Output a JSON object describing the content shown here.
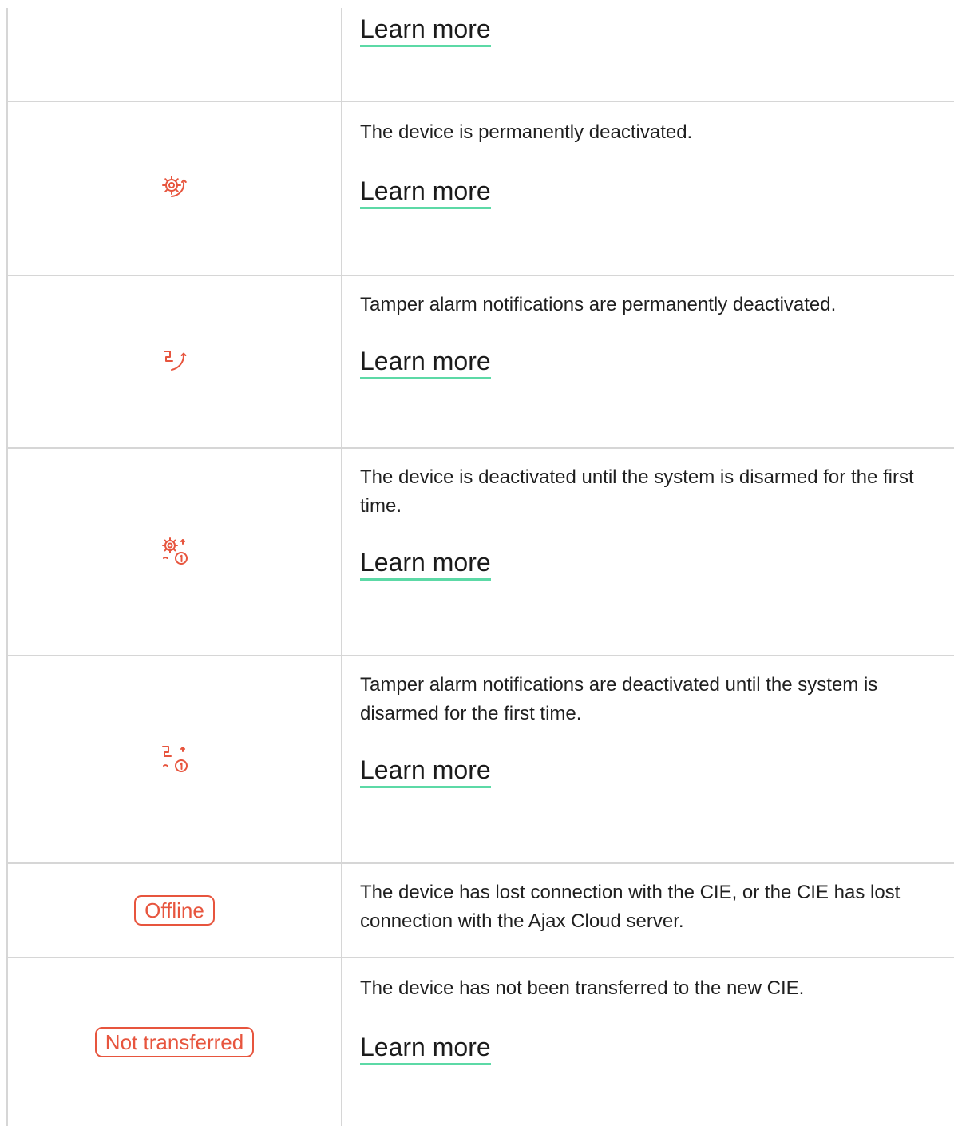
{
  "colors": {
    "accent_red": "#e7553e",
    "link_underline": "#5cd9a6",
    "grid": "#d6d6d6"
  },
  "rows": [
    {
      "learn_more": "Learn more"
    },
    {
      "icon": "device-deactivated-icon",
      "description": "The device is permanently deactivated.",
      "learn_more": "Learn more"
    },
    {
      "icon": "tamper-deactivated-icon",
      "description": "Tamper alarm notifications are permanently deactivated.",
      "learn_more": "Learn more"
    },
    {
      "icon": "device-deactivated-until-disarm-icon",
      "description": "The device is deactivated until the system is disarmed for the first time.",
      "learn_more": "Learn more"
    },
    {
      "icon": "tamper-deactivated-until-disarm-icon",
      "description": "Tamper alarm notifications are deactivated until the system is disarmed for the first time.",
      "learn_more": "Learn more"
    },
    {
      "badge": "Offline",
      "description": "The device has lost connection with the CIE, or the CIE has lost connection with the Ajax Cloud server."
    },
    {
      "badge": "Not transferred",
      "description": "The device has not been transferred to the new CIE.",
      "learn_more": "Learn more"
    }
  ]
}
